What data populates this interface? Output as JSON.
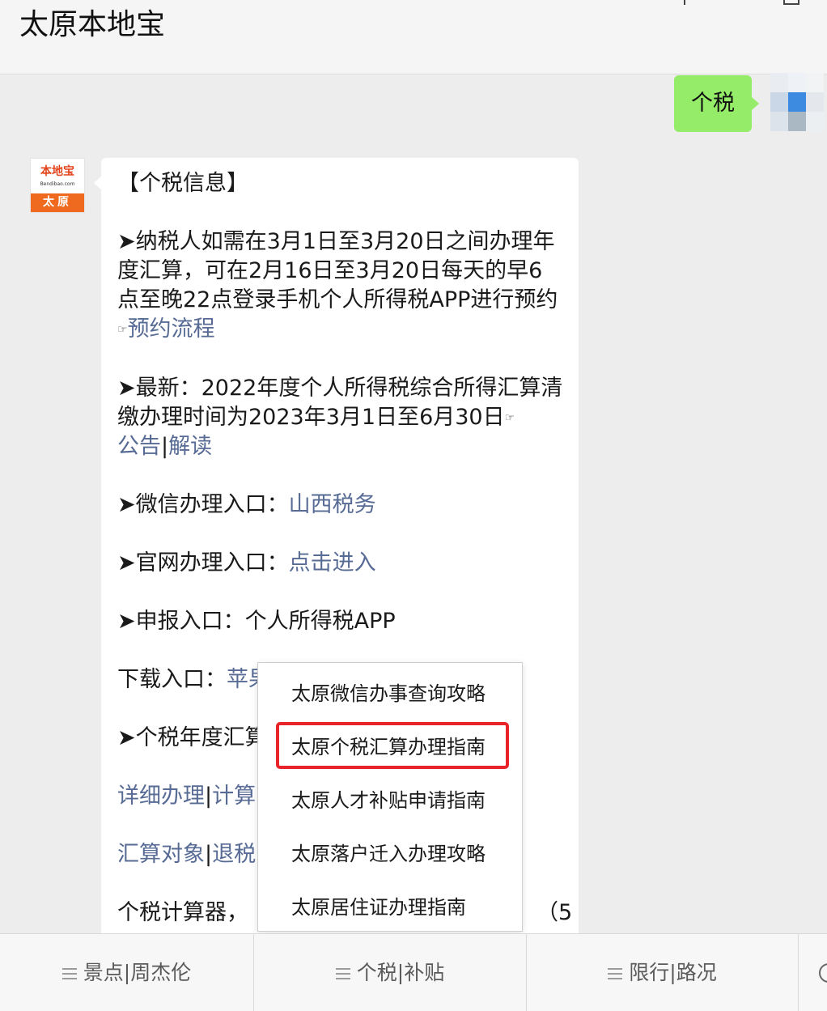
{
  "window": {
    "title": "太原本地宝"
  },
  "outgoing_message": {
    "text": "个税"
  },
  "bot": {
    "avatar_top": "本地宝",
    "avatar_url": "Bendibao.com",
    "avatar_city": "太原"
  },
  "message": {
    "heading": "【个税信息】",
    "p1_text": "➤纳税人如需在3月1日至3月20日之间办理年度汇算，可在2月16日至3月20日每天的早6点至晚22点登录手机个人所得税APP进行预约",
    "p1_hand": "☞",
    "p1_link": "预约流程",
    "p2_text": "➤最新：2022年度个人所得税综合所得汇算清缴办理时间为2023年3月1日至6月30日",
    "p2_hand": "☞",
    "p2_link1": "公告",
    "p2_sep": "|",
    "p2_link2": "解读",
    "p3_label": "➤微信办理入口：",
    "p3_link": "山西税务",
    "p4_label": "➤官网办理入口：",
    "p4_link": "点击进入",
    "p5_text": "➤申报入口：个人所得税APP",
    "p6_label": "下载入口：",
    "p6_link": "苹果",
    "p7_text": "➤个税年度汇算",
    "p8_link1": "详细办理",
    "p8_sep": "|",
    "p8_link2": "计算",
    "p9_link1": "汇算对象",
    "p9_sep": "|",
    "p9_link2": "退税",
    "p10_text": "个税计算器，",
    "p10_tail": "（5"
  },
  "popup_menu": {
    "items": [
      "太原微信办事查询攻略",
      "太原个税汇算办理指南",
      "太原人才补贴申请指南",
      "太原落户迁入办理攻略",
      "太原居住证办理指南"
    ],
    "highlighted_index": 1,
    "highlight_color": "#e8232a"
  },
  "bottom_menu": {
    "tabs": [
      "景点|周杰伦",
      "个税|补贴",
      "限行|路况"
    ]
  },
  "colors": {
    "outgoing_bubble": "#95ec69",
    "link": "#576b95",
    "background": "#ededed"
  }
}
